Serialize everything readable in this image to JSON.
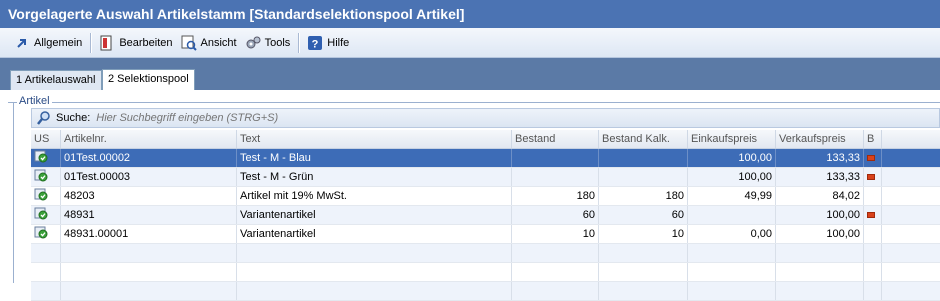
{
  "window": {
    "title": "Vorgelagerte Auswahl Artikelstamm [Standardselektionspool Artikel]"
  },
  "toolbar": {
    "items": [
      {
        "label": "Allgemein",
        "icon": "arrow-icon"
      },
      {
        "label": "Bearbeiten",
        "icon": "edit-icon"
      },
      {
        "label": "Ansicht",
        "icon": "view-icon"
      },
      {
        "label": "Tools",
        "icon": "gears-icon"
      },
      {
        "label": "Hilfe",
        "icon": "help-icon"
      }
    ]
  },
  "tabs": [
    {
      "label": "1 Artikelauswahl",
      "active": false
    },
    {
      "label": "2 Selektionspool",
      "active": true
    }
  ],
  "group": {
    "label": "Artikel"
  },
  "search": {
    "label": "Suche:",
    "placeholder": "Hier Suchbegriff eingeben (STRG+S)"
  },
  "table": {
    "columns": [
      "US",
      "Artikelnr.",
      "Text",
      "Bestand",
      "Bestand Kalk.",
      "Einkaufspreis",
      "Verkaufspreis",
      "B"
    ],
    "rows": [
      {
        "artikelnr": "01Test.00002",
        "text": "Test - M - Blau",
        "bestand": "",
        "bestand_kalk": "",
        "ek": "100,00",
        "vk": "133,33",
        "flag": true,
        "selected": true
      },
      {
        "artikelnr": "01Test.00003",
        "text": "Test - M - Grün",
        "bestand": "",
        "bestand_kalk": "",
        "ek": "100,00",
        "vk": "133,33",
        "flag": true,
        "selected": false
      },
      {
        "artikelnr": "48203",
        "text": "Artikel mit 19% MwSt.",
        "bestand": "180",
        "bestand_kalk": "180",
        "ek": "49,99",
        "vk": "84,02",
        "flag": false,
        "selected": false
      },
      {
        "artikelnr": "48931",
        "text": "Variantenartikel",
        "bestand": "60",
        "bestand_kalk": "60",
        "ek": "",
        "vk": "100,00",
        "flag": true,
        "selected": false
      },
      {
        "artikelnr": "48931.00001",
        "text": "Variantenartikel",
        "bestand": "10",
        "bestand_kalk": "10",
        "ek": "0,00",
        "vk": "100,00",
        "flag": false,
        "selected": false
      }
    ]
  },
  "colors": {
    "title_bg": "#4b73b3",
    "selected_row": "#3d6cb7",
    "flag": "#d9421a"
  }
}
